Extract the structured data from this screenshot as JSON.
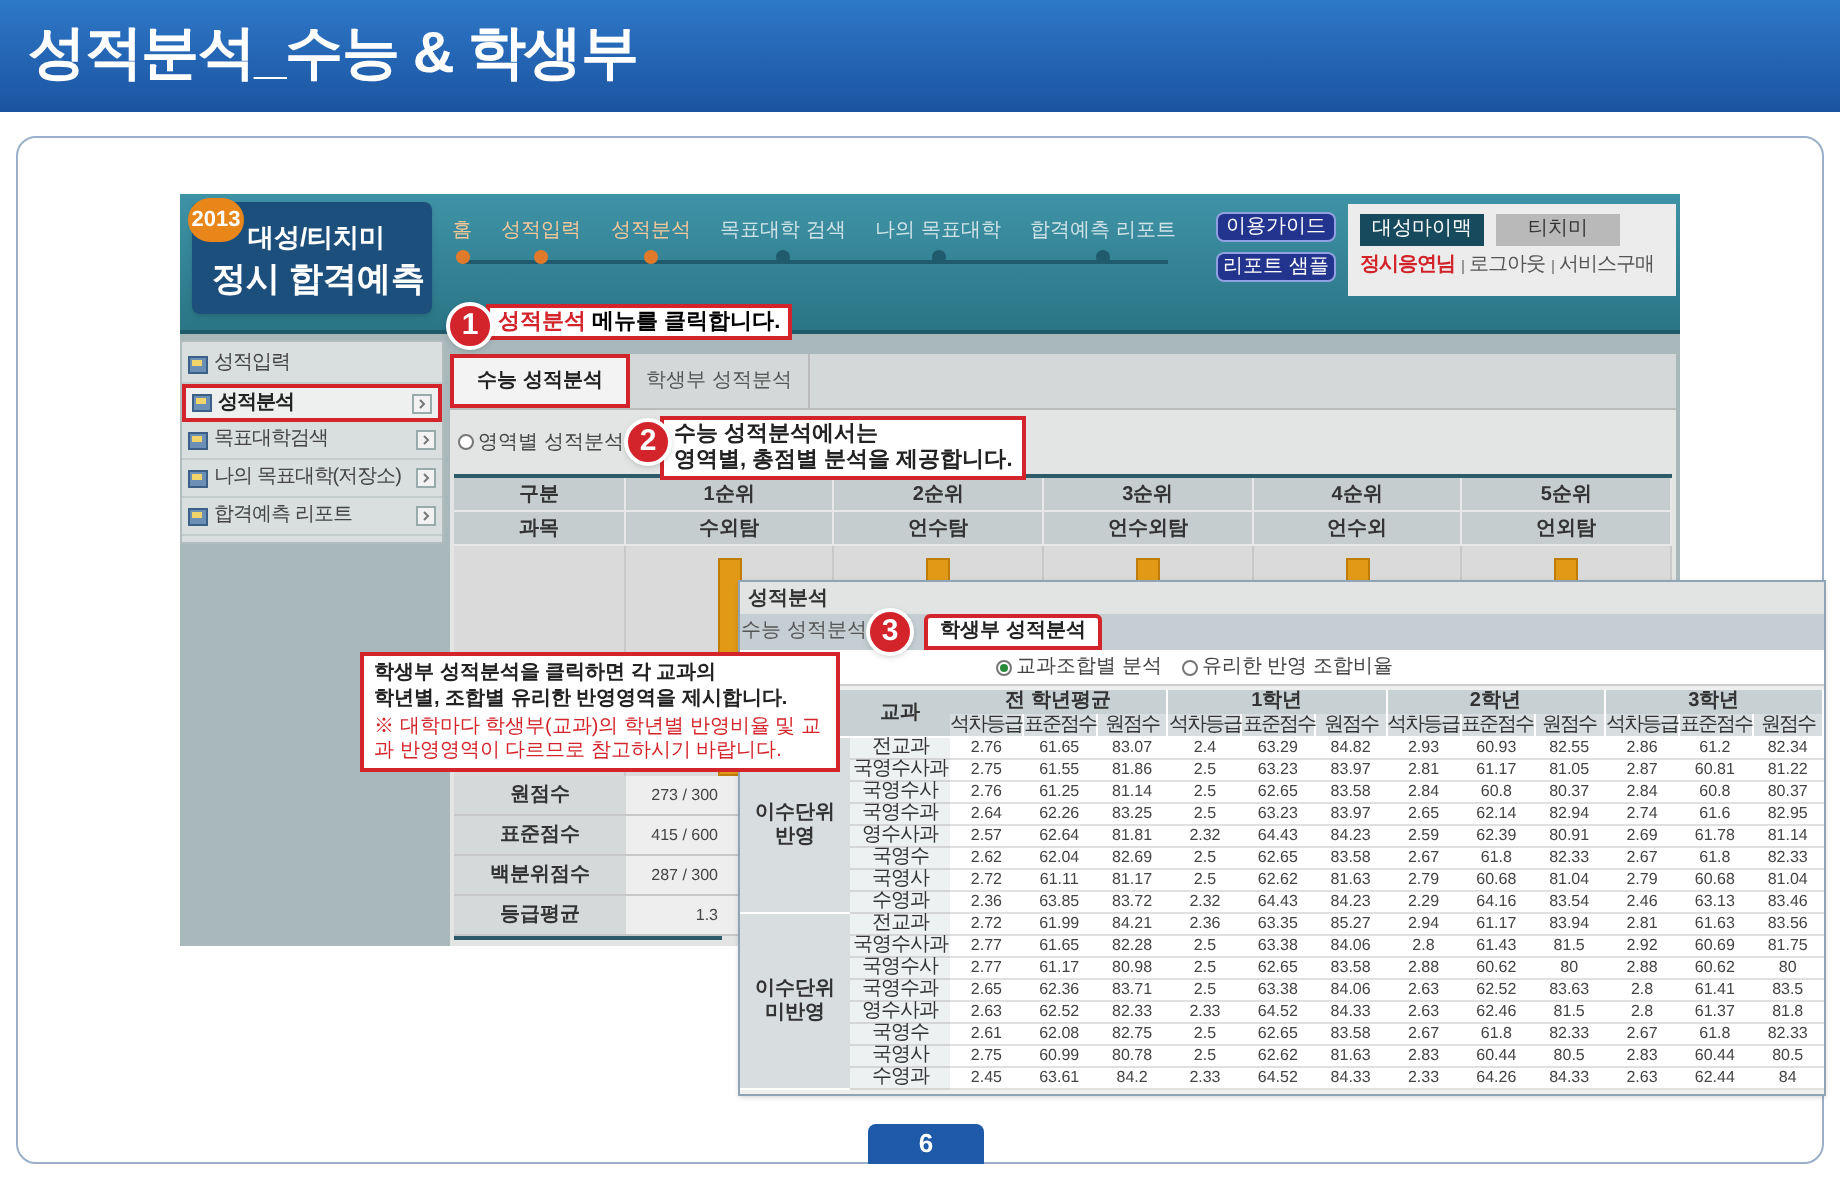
{
  "page_title": "성적분석_수능 & 학생부",
  "app": {
    "logo": {
      "year": "2013",
      "line1": "대성/티치미",
      "line2": "정시 합격예측"
    },
    "steps": [
      {
        "label": "홈",
        "done": true
      },
      {
        "label": "성적입력",
        "done": true
      },
      {
        "label": "성적분석",
        "done": true
      },
      {
        "label": "목표대학 검색",
        "done": false
      },
      {
        "label": "나의 목표대학",
        "done": false
      },
      {
        "label": "합격예측 리포트",
        "done": false
      }
    ],
    "header_buttons": [
      "이용가이드",
      "리포트 샘플"
    ],
    "site_tabs": [
      {
        "label": "대성마이맥",
        "selected": true
      },
      {
        "label": "티치미",
        "selected": false
      }
    ],
    "user_links": [
      {
        "label": "정시응연님",
        "kind": "user"
      },
      {
        "label": "로그아웃",
        "kind": "link"
      },
      {
        "label": "서비스구매",
        "kind": "link"
      }
    ],
    "sidebar": [
      {
        "label": "성적입력",
        "selected": false,
        "arrow": false
      },
      {
        "label": "성적분석",
        "selected": true,
        "arrow": true
      },
      {
        "label": "목표대학검색",
        "selected": false,
        "arrow": true
      },
      {
        "label": "나의 목표대학(저장소)",
        "selected": false,
        "arrow": true
      },
      {
        "label": "합격예측 리포트",
        "selected": false,
        "arrow": true
      }
    ],
    "tabs": [
      {
        "label": "수능 성적분석",
        "selected": true
      },
      {
        "label": "학생부 성적분석",
        "selected": false
      }
    ],
    "radios": [
      {
        "label": "영역별 성적분석",
        "selected": false
      }
    ],
    "table": {
      "head": [
        [
          "구분",
          "1순위",
          "2순위",
          "3순위",
          "4순위",
          "5순위"
        ],
        [
          "과목",
          "수외탐",
          "언수탐",
          "언수외탐",
          "언수외",
          "언외탐"
        ]
      ],
      "rows": [
        [
          "원점수",
          "273 / 300"
        ],
        [
          "표준점수",
          "415 / 600"
        ],
        [
          "백분위점수",
          "287 / 300"
        ],
        [
          "등급평균",
          "1.3"
        ]
      ]
    }
  },
  "inner": {
    "title": "성적분석",
    "tabs": [
      {
        "label": "수능 성적분석",
        "selected": false
      },
      {
        "label": "학생부 성적분석",
        "selected": true
      }
    ],
    "radios": [
      {
        "label": "교과조합별 분석",
        "selected": true
      },
      {
        "label": "유리한 반영 조합비율",
        "selected": false
      }
    ],
    "subject_header": "교과",
    "years": [
      {
        "label": "전 학년평균",
        "measures": [
          "석차등급",
          "표준점수",
          "원점수"
        ]
      },
      {
        "label": "1학년",
        "measures": [
          "석차등급",
          "표준점수",
          "원점수"
        ]
      },
      {
        "label": "2학년",
        "measures": [
          "석차등급",
          "표준점수",
          "원점수"
        ]
      },
      {
        "label": "3학년",
        "measures": [
          "석차등급",
          "표준점수",
          "원점수"
        ]
      }
    ],
    "groups": [
      {
        "label": "이수단위 반영",
        "rows": [
          [
            "전교과",
            "2.76",
            "61.65",
            "83.07",
            "2.4",
            "63.29",
            "84.82",
            "2.93",
            "60.93",
            "82.55",
            "2.86",
            "61.2",
            "82.34"
          ],
          [
            "국영수사과",
            "2.75",
            "61.55",
            "81.86",
            "2.5",
            "63.23",
            "83.97",
            "2.81",
            "61.17",
            "81.05",
            "2.87",
            "60.81",
            "81.22"
          ],
          [
            "국영수사",
            "2.76",
            "61.25",
            "81.14",
            "2.5",
            "62.65",
            "83.58",
            "2.84",
            "60.8",
            "80.37",
            "2.84",
            "60.8",
            "80.37"
          ],
          [
            "국영수과",
            "2.64",
            "62.26",
            "83.25",
            "2.5",
            "63.23",
            "83.97",
            "2.65",
            "62.14",
            "82.94",
            "2.74",
            "61.6",
            "82.95"
          ],
          [
            "영수사과",
            "2.57",
            "62.64",
            "81.81",
            "2.32",
            "64.43",
            "84.23",
            "2.59",
            "62.39",
            "80.91",
            "2.69",
            "61.78",
            "81.14"
          ],
          [
            "국영수",
            "2.62",
            "62.04",
            "82.69",
            "2.5",
            "62.65",
            "83.58",
            "2.67",
            "61.8",
            "82.33",
            "2.67",
            "61.8",
            "82.33"
          ],
          [
            "국영사",
            "2.72",
            "61.11",
            "81.17",
            "2.5",
            "62.62",
            "81.63",
            "2.79",
            "60.68",
            "81.04",
            "2.79",
            "60.68",
            "81.04"
          ],
          [
            "수영과",
            "2.36",
            "63.85",
            "83.72",
            "2.32",
            "64.43",
            "84.23",
            "2.29",
            "64.16",
            "83.54",
            "2.46",
            "63.13",
            "83.46"
          ]
        ]
      },
      {
        "label": "이수단위 미반영",
        "rows": [
          [
            "전교과",
            "2.72",
            "61.99",
            "84.21",
            "2.36",
            "63.35",
            "85.27",
            "2.94",
            "61.17",
            "83.94",
            "2.81",
            "61.63",
            "83.56"
          ],
          [
            "국영수사과",
            "2.77",
            "61.65",
            "82.28",
            "2.5",
            "63.38",
            "84.06",
            "2.8",
            "61.43",
            "81.5",
            "2.92",
            "60.69",
            "81.75"
          ],
          [
            "국영수사",
            "2.77",
            "61.17",
            "80.98",
            "2.5",
            "62.65",
            "83.58",
            "2.88",
            "60.62",
            "80",
            "2.88",
            "60.62",
            "80"
          ],
          [
            "국영수과",
            "2.65",
            "62.36",
            "83.71",
            "2.5",
            "63.38",
            "84.06",
            "2.63",
            "62.52",
            "83.63",
            "2.8",
            "61.41",
            "83.5"
          ],
          [
            "영수사과",
            "2.63",
            "62.52",
            "82.33",
            "2.33",
            "64.52",
            "84.33",
            "2.63",
            "62.46",
            "81.5",
            "2.8",
            "61.37",
            "81.8"
          ],
          [
            "국영수",
            "2.61",
            "62.08",
            "82.75",
            "2.5",
            "62.65",
            "83.58",
            "2.67",
            "61.8",
            "82.33",
            "2.67",
            "61.8",
            "82.33"
          ],
          [
            "국영사",
            "2.75",
            "60.99",
            "80.78",
            "2.5",
            "62.62",
            "81.63",
            "2.83",
            "60.44",
            "80.5",
            "2.83",
            "60.44",
            "80.5"
          ],
          [
            "수영과",
            "2.45",
            "63.61",
            "84.2",
            "2.33",
            "64.52",
            "84.33",
            "2.33",
            "64.26",
            "84.33",
            "2.63",
            "62.44",
            "84"
          ]
        ]
      }
    ]
  },
  "callouts": [
    {
      "number": "1",
      "highlight": "성적분석",
      "text": "메뉴를 클릭합니다."
    },
    {
      "number": "2",
      "lines": [
        "수능 성적분석에서는",
        "영역별, 총점별 분석을 제공합니다."
      ]
    },
    {
      "number": "3",
      "lines": [
        "학생부 성적분석을 클릭하면 각 교과의",
        "학년별, 조합별 유리한 반영영역을 제시합니다."
      ],
      "note": "※ 대학마다 학생부(교과)의 학년별 반영비율 및 교과 반영영역이 다르므로 참고하시기 바랍니다."
    }
  ],
  "page_number": "6"
}
